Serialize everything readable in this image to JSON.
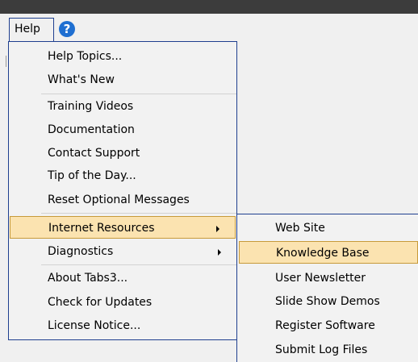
{
  "menubar": {
    "help_label": "Help"
  },
  "help_icon": "question-mark-icon",
  "colors": {
    "highlight": "#fbe3b0",
    "highlight_border": "#c79a3a",
    "menu_border": "#1f3f8f",
    "help_icon": "#1f6fd1"
  },
  "help_menu": {
    "items": [
      "Help Topics...",
      "What's New",
      "Training Videos",
      "Documentation",
      "Contact Support",
      "Tip of the Day...",
      "Reset Optional Messages",
      "Internet Resources",
      "Diagnostics",
      "About Tabs3...",
      "Check for Updates",
      "License Notice..."
    ],
    "highlighted": "Internet Resources"
  },
  "internet_resources_submenu": {
    "items": [
      "Web Site",
      "Knowledge Base",
      "User Newsletter",
      "Slide Show Demos",
      "Register Software",
      "Submit Log Files"
    ],
    "highlighted": "Knowledge Base"
  }
}
